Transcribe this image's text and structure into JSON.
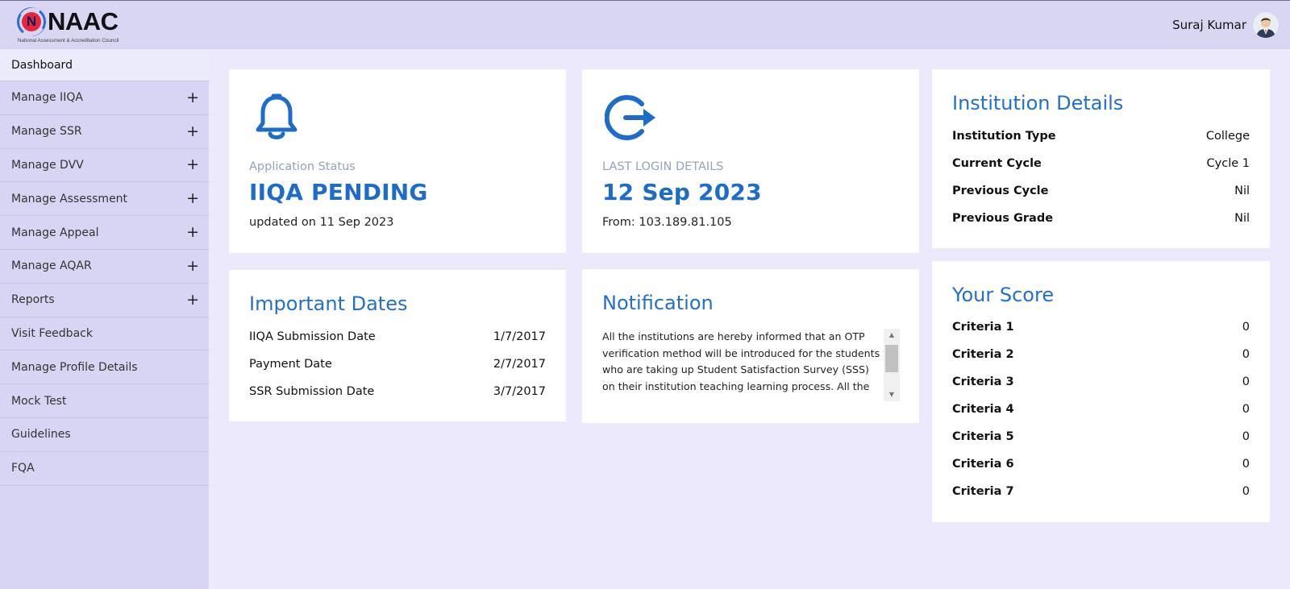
{
  "header": {
    "logo_letter": "N",
    "logo_text": "NAAC",
    "logo_subtitle": "National Assessment & Accreditation Council",
    "user_name": "Suraj Kumar"
  },
  "sidebar": {
    "items": [
      {
        "label": "Dashboard",
        "expandable": false,
        "active": true
      },
      {
        "label": "Manage IIQA",
        "expandable": true
      },
      {
        "label": "Manage SSR",
        "expandable": true
      },
      {
        "label": "Manage DVV",
        "expandable": true
      },
      {
        "label": "Manage Assessment",
        "expandable": true
      },
      {
        "label": "Manage Appeal",
        "expandable": true
      },
      {
        "label": "Manage AQAR",
        "expandable": true
      },
      {
        "label": "Reports",
        "expandable": true
      },
      {
        "label": "Visit Feedback",
        "expandable": false
      },
      {
        "label": "Manage Profile Details",
        "expandable": false
      },
      {
        "label": "Mock Test",
        "expandable": false
      },
      {
        "label": "Guidelines",
        "expandable": false
      },
      {
        "label": "FQA",
        "expandable": false
      }
    ],
    "expand_symbol": "+"
  },
  "app_status": {
    "icon": "bell-icon",
    "label": "Application Status",
    "value": "IIQA PENDING",
    "sub": "updated on 11 Sep 2023"
  },
  "last_login": {
    "icon": "logout-icon",
    "label": "LAST LOGIN DETAILS",
    "value": "12 Sep 2023",
    "sub": "From: 103.189.81.105"
  },
  "institution": {
    "title": "Institution Details",
    "rows": [
      {
        "key": "Institution Type",
        "value": "College"
      },
      {
        "key": "Current Cycle",
        "value": "Cycle 1"
      },
      {
        "key": "Previous Cycle",
        "value": "Nil"
      },
      {
        "key": "Previous Grade",
        "value": "Nil"
      }
    ]
  },
  "important_dates": {
    "title": "Important Dates",
    "rows": [
      {
        "key": "IIQA Submission Date",
        "value": "1/7/2017"
      },
      {
        "key": "Payment Date",
        "value": "2/7/2017"
      },
      {
        "key": "SSR Submission Date",
        "value": "3/7/2017"
      }
    ]
  },
  "notification": {
    "title": "Notification",
    "text": "All the institutions are hereby informed that an OTP verification method will be introduced for the students who are taking up Student Satisfaction Survey (SSS) on their institution teaching learning process. All the"
  },
  "score": {
    "title": "Your Score",
    "rows": [
      {
        "key": "Criteria 1",
        "value": "0"
      },
      {
        "key": "Criteria 2",
        "value": "0"
      },
      {
        "key": "Criteria 3",
        "value": "0"
      },
      {
        "key": "Criteria 4",
        "value": "0"
      },
      {
        "key": "Criteria 5",
        "value": "0"
      },
      {
        "key": "Criteria 6",
        "value": "0"
      },
      {
        "key": "Criteria 7",
        "value": "0"
      }
    ]
  },
  "colors": {
    "accent": "#1d6ccb",
    "header_bg": "#d8d6f2",
    "sidebar_bg": "#d7d5f3",
    "page_bg": "#ebe9fb"
  }
}
